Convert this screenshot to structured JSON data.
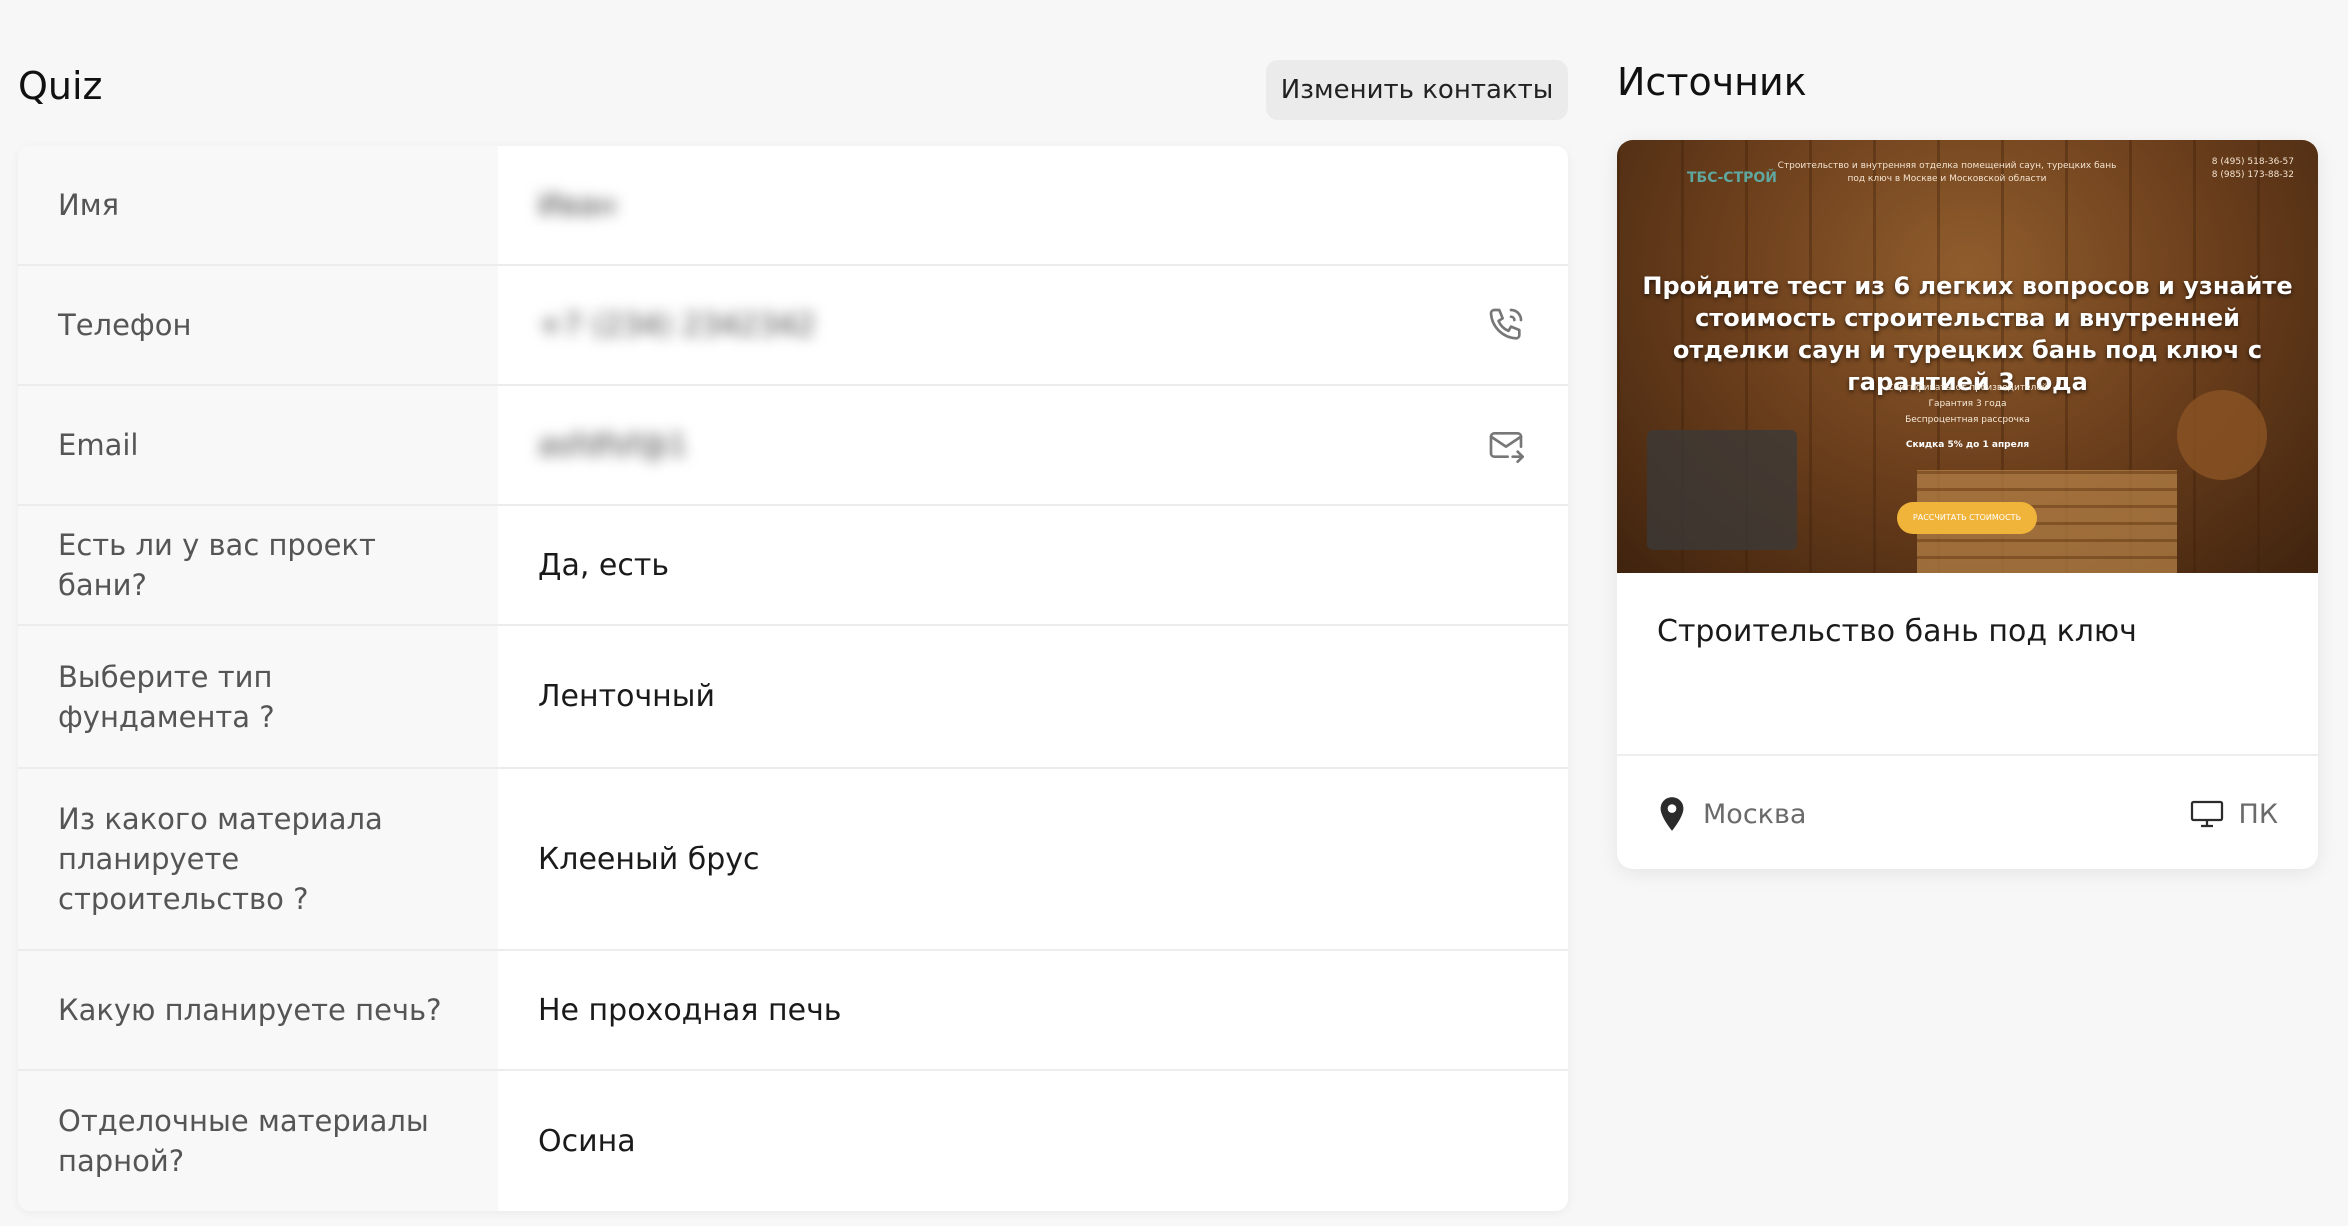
{
  "quiz": {
    "title": "Quiz",
    "edit_contacts_label": "Изменить контакты",
    "rows": [
      {
        "label": "Имя",
        "value": "Иван"
      },
      {
        "label": "Телефон",
        "value": "+7 (234) 2342342"
      },
      {
        "label": "Email",
        "value": "asfdfsf@1"
      },
      {
        "label": "Есть ли у вас проект бани?",
        "value": "Да, есть"
      },
      {
        "label": "Выберите тип фундамента ?",
        "value": "Ленточный"
      },
      {
        "label": "Из какого материала планируете строительство ?",
        "value": "Клееный брус"
      },
      {
        "label": "Какую планируете печь?",
        "value": "Не проходная печь"
      },
      {
        "label": "Отделочные материалы парной?",
        "value": "Осина"
      }
    ]
  },
  "source": {
    "title": "Источник",
    "preview": {
      "logo": "ТБС-СТРОЙ",
      "topline": "Строительство и внутренняя отделка помещений саун, турецких бань под ключ в Москве и Московской области",
      "phones": [
        "8 (495) 518-36-57",
        "8 (985) 173-88-32"
      ],
      "headline": "Пройдите тест из 6 легких вопросов и узнайте стоимость строительства и внутренней отделки саун и турецких бань под ключ с гарантией 3 года",
      "bullets": [
        "Сертификаты от производителей",
        "Гарантия 3 года",
        "Беспроцентная рассрочка"
      ],
      "discount": "Скидка 5% до 1 апреля",
      "cta": "РАССЧИТАТЬ СТОИМОСТЬ"
    },
    "name": "Строительство бань под ключ",
    "location": "Москва",
    "device": "ПК"
  },
  "icons": {
    "phone": "phone-icon",
    "email": "mail-icon",
    "location": "location-pin-icon",
    "device": "monitor-icon"
  },
  "colors": {
    "background": "#f7f7f7",
    "card": "#ffffff",
    "label_bg": "#f8f8f8",
    "button_bg": "#ebebeb",
    "cta": "#f0b43a"
  }
}
